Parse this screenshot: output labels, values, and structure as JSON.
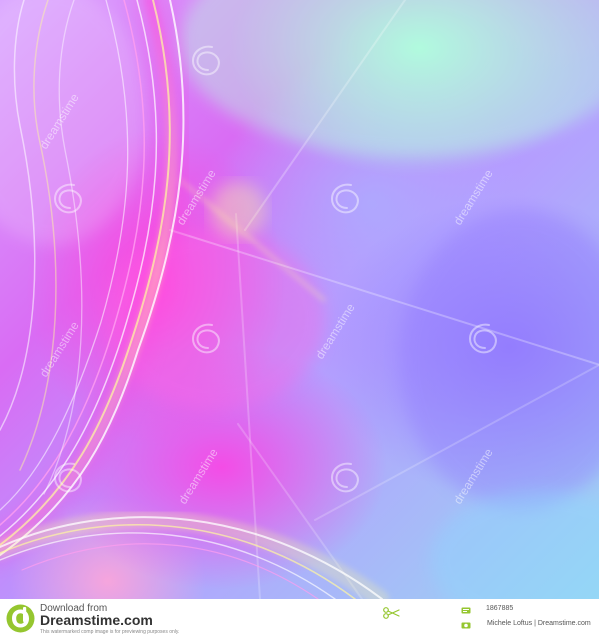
{
  "artwork": {
    "watermark_text": "dreamstime",
    "colors": {
      "magenta": "#ff42dd",
      "violet": "#9b78ff",
      "lavender": "#d8a6ff",
      "mint": "#b8ffe0",
      "light_blue": "#9ad6f2",
      "pale_yellow": "#fff6a0",
      "white_glow": "#ffffff"
    }
  },
  "footer": {
    "download_label": "Download from",
    "brand_label": "Dreamstime.com",
    "comp_notice": "This watermarked comp image is for previewing purposes only.",
    "image_id": "1867885",
    "credit": "Michele Loftus | Dreamstime.com",
    "logo_icon": "dreamstime-logo-icon",
    "scissors_icon": "scissors-icon",
    "id_icon": "image-id-icon",
    "credit_icon": "credit-icon",
    "colors": {
      "logo": "#95c62f",
      "text": "#555555",
      "brand": "#333333",
      "note": "#888888"
    }
  }
}
